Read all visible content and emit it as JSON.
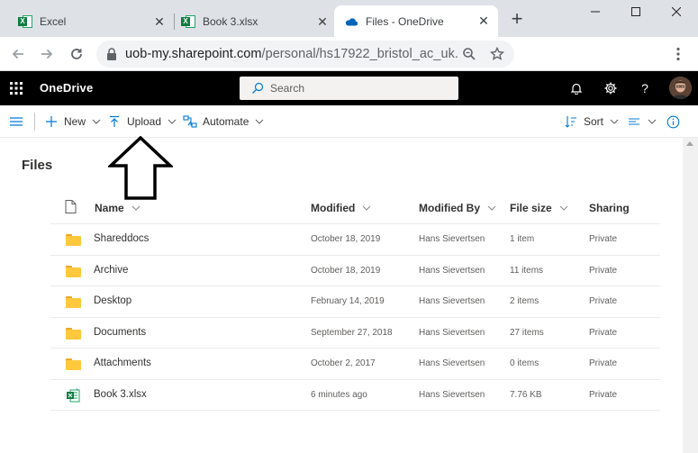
{
  "browser": {
    "tabs": [
      {
        "title": "Excel",
        "icon": "excel-icon",
        "active": false
      },
      {
        "title": "Book 3.xlsx",
        "icon": "excel-icon",
        "active": false
      },
      {
        "title": "Files - OneDrive",
        "icon": "onedrive-cloud-icon",
        "active": true
      }
    ],
    "new_tab": "+",
    "url_host": "uob-my.sharepoint.com",
    "url_path": "/personal/hs17922_bristol_ac_uk..."
  },
  "suitebar": {
    "app_name": "OneDrive",
    "search_placeholder": "Search",
    "help": "?"
  },
  "commands": {
    "new": "New",
    "upload": "Upload",
    "automate": "Automate",
    "sort": "Sort"
  },
  "page_title": "Files",
  "columns": {
    "name": "Name",
    "modified": "Modified",
    "modified_by": "Modified By",
    "file_size": "File size",
    "sharing": "Sharing"
  },
  "files": [
    {
      "name": "Shareddocs",
      "type": "folder",
      "modified": "October 18, 2019",
      "modified_by": "Hans Sievertsen",
      "size": "1 item",
      "sharing": "Private"
    },
    {
      "name": "Archive",
      "type": "folder",
      "modified": "October 18, 2019",
      "modified_by": "Hans Sievertsen",
      "size": "11 items",
      "sharing": "Private"
    },
    {
      "name": "Desktop",
      "type": "folder",
      "modified": "February 14, 2019",
      "modified_by": "Hans Sievertsen",
      "size": "2 items",
      "sharing": "Private"
    },
    {
      "name": "Documents",
      "type": "folder",
      "modified": "September 27, 2018",
      "modified_by": "Hans Sievertsen",
      "size": "27 items",
      "sharing": "Private"
    },
    {
      "name": "Attachments",
      "type": "folder",
      "modified": "October 2, 2017",
      "modified_by": "Hans Sievertsen",
      "size": "0 items",
      "sharing": "Private"
    },
    {
      "name": "Book 3.xlsx",
      "type": "xlsx",
      "modified": "6 minutes ago",
      "modified_by": "Hans Sievertsen",
      "size": "7.76 KB",
      "sharing": "Private"
    }
  ],
  "colors": {
    "suitebar": "#000000",
    "accent": "#0078d4",
    "folder": "#ffc83d",
    "excel": "#107c41"
  }
}
